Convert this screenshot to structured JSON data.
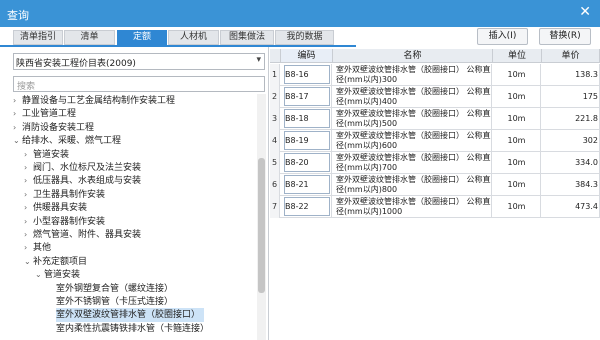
{
  "window": {
    "title": "查询",
    "close_glyph": "✕"
  },
  "tabs": [
    {
      "label": "清单指引"
    },
    {
      "label": "清单"
    },
    {
      "label": "定额",
      "active": true
    },
    {
      "label": "人材机"
    },
    {
      "label": "图集做法"
    },
    {
      "label": "我的数据"
    }
  ],
  "buttons": {
    "insert": "插入(I)",
    "replace": "替换(R)"
  },
  "library": {
    "selected": "陕西省安装工程价目表(2009)",
    "search_placeholder": "搜索"
  },
  "tree": [
    {
      "label": "静置设备与工艺金属结构制作安装工程",
      "level": 0,
      "arrow": "›"
    },
    {
      "label": "工业管道工程",
      "level": 0,
      "arrow": "›"
    },
    {
      "label": "消防设备安装工程",
      "level": 0,
      "arrow": "›"
    },
    {
      "label": "给排水、采暖、燃气工程",
      "level": 0,
      "arrow": "⌄"
    },
    {
      "label": "管道安装",
      "level": 1,
      "arrow": "›"
    },
    {
      "label": "阀门、水位标尺及法兰安装",
      "level": 1,
      "arrow": "›"
    },
    {
      "label": "低压器具、水表组成与安装",
      "level": 1,
      "arrow": "›"
    },
    {
      "label": "卫生器具制作安装",
      "level": 1,
      "arrow": "›"
    },
    {
      "label": "供暖器具安装",
      "level": 1,
      "arrow": "›"
    },
    {
      "label": "小型容器制作安装",
      "level": 1,
      "arrow": "›"
    },
    {
      "label": "燃气管道、附件、器具安装",
      "level": 1,
      "arrow": "›"
    },
    {
      "label": "其他",
      "level": 1,
      "arrow": "›"
    },
    {
      "label": "补充定额项目",
      "level": 1,
      "arrow": "⌄"
    },
    {
      "label": "管道安装",
      "level": 2,
      "arrow": "⌄"
    },
    {
      "label": "室外钢塑复合管（螺纹连接）",
      "level": 3,
      "arrow": ""
    },
    {
      "label": "室外不锈钢管（卡压式连接）",
      "level": 3,
      "arrow": ""
    },
    {
      "label": "室外双壁波纹管排水管（胶圈接口）",
      "level": 3,
      "arrow": "",
      "selected": true
    },
    {
      "label": "室内柔性抗震铸铁排水管（卡箍连接）",
      "level": 3,
      "arrow": ""
    }
  ],
  "grid": {
    "headers": {
      "code": "编码",
      "name": "名称",
      "unit": "单位",
      "price": "单价"
    },
    "rows": [
      {
        "index": "1",
        "code": "B8-16",
        "name": "室外双壁波纹管排水管（胶圈接口） 公称直径(mm以内)300",
        "unit": "10m",
        "price": "138.3"
      },
      {
        "index": "2",
        "code": "B8-17",
        "name": "室外双壁波纹管排水管（胶圈接口） 公称直径(mm以内)400",
        "unit": "10m",
        "price": "175"
      },
      {
        "index": "3",
        "code": "B8-18",
        "name": "室外双壁波纹管排水管（胶圈接口） 公称直径(mm以内)500",
        "unit": "10m",
        "price": "221.8"
      },
      {
        "index": "4",
        "code": "B8-19",
        "name": "室外双壁波纹管排水管（胶圈接口） 公称直径(mm以内)600",
        "unit": "10m",
        "price": "302"
      },
      {
        "index": "5",
        "code": "B8-20",
        "name": "室外双壁波纹管排水管（胶圈接口） 公称直径(mm以内)700",
        "unit": "10m",
        "price": "334.0"
      },
      {
        "index": "6",
        "code": "B8-21",
        "name": "室外双壁波纹管排水管（胶圈接口） 公称直径(mm以内)800",
        "unit": "10m",
        "price": "384.3"
      },
      {
        "index": "7",
        "code": "B8-22",
        "name": "室外双壁波纹管排水管（胶圈接口） 公称直径(mm以内)1000",
        "unit": "10m",
        "price": "473.4"
      }
    ]
  }
}
